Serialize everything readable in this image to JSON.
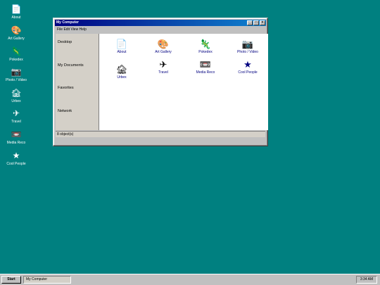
{
  "desktop": {
    "icons": [
      {
        "label": "About",
        "icon": "document-icon",
        "glyph": "📄"
      },
      {
        "label": "Art Gallery",
        "icon": "palette-icon",
        "glyph": "🎨"
      },
      {
        "label": "Pokedex",
        "icon": "lizard-icon",
        "glyph": "🦎"
      },
      {
        "label": "Photo / Video",
        "icon": "camera-icon",
        "glyph": "📷"
      },
      {
        "label": "Urbex",
        "icon": "house-icon",
        "glyph": "🏚"
      },
      {
        "label": "Travel",
        "icon": "airplane-icon",
        "glyph": "✈"
      },
      {
        "label": "Media Reco",
        "icon": "cassette-icon",
        "glyph": "📼"
      },
      {
        "label": "Cool People",
        "icon": "star-icon",
        "glyph": "★"
      }
    ]
  },
  "window": {
    "title": "My Computer",
    "buttons": {
      "minimize": "_",
      "maximize": "□",
      "close": "×"
    },
    "menu": "File  Edit  View  Help",
    "sidebar": [
      "Desktop",
      "My Documents",
      "Favorites",
      "Network"
    ],
    "files": [
      {
        "label": "About",
        "icon": "document-icon",
        "glyph": "📄"
      },
      {
        "label": "Art Gallery",
        "icon": "palette-icon",
        "glyph": "🎨"
      },
      {
        "label": "Pokedex",
        "icon": "lizard-icon",
        "glyph": "🦎"
      },
      {
        "label": "Photo / Video",
        "icon": "camera-icon",
        "glyph": "📷"
      },
      {
        "label": "Urbex",
        "icon": "house-icon",
        "glyph": "🏚"
      },
      {
        "label": "Travel",
        "icon": "airplane-icon",
        "glyph": "✈"
      },
      {
        "label": "Media Reco",
        "icon": "cassette-icon",
        "glyph": "📼"
      },
      {
        "label": "Cool People",
        "icon": "star-icon",
        "glyph": "★"
      }
    ],
    "status": "8 object(s)"
  },
  "taskbar": {
    "start_label": "Start",
    "task_label": "My Computer",
    "clock": "3:34 AM"
  },
  "colors": {
    "desktop": "#008080",
    "titlebar": "#000080",
    "link": "#000080"
  }
}
